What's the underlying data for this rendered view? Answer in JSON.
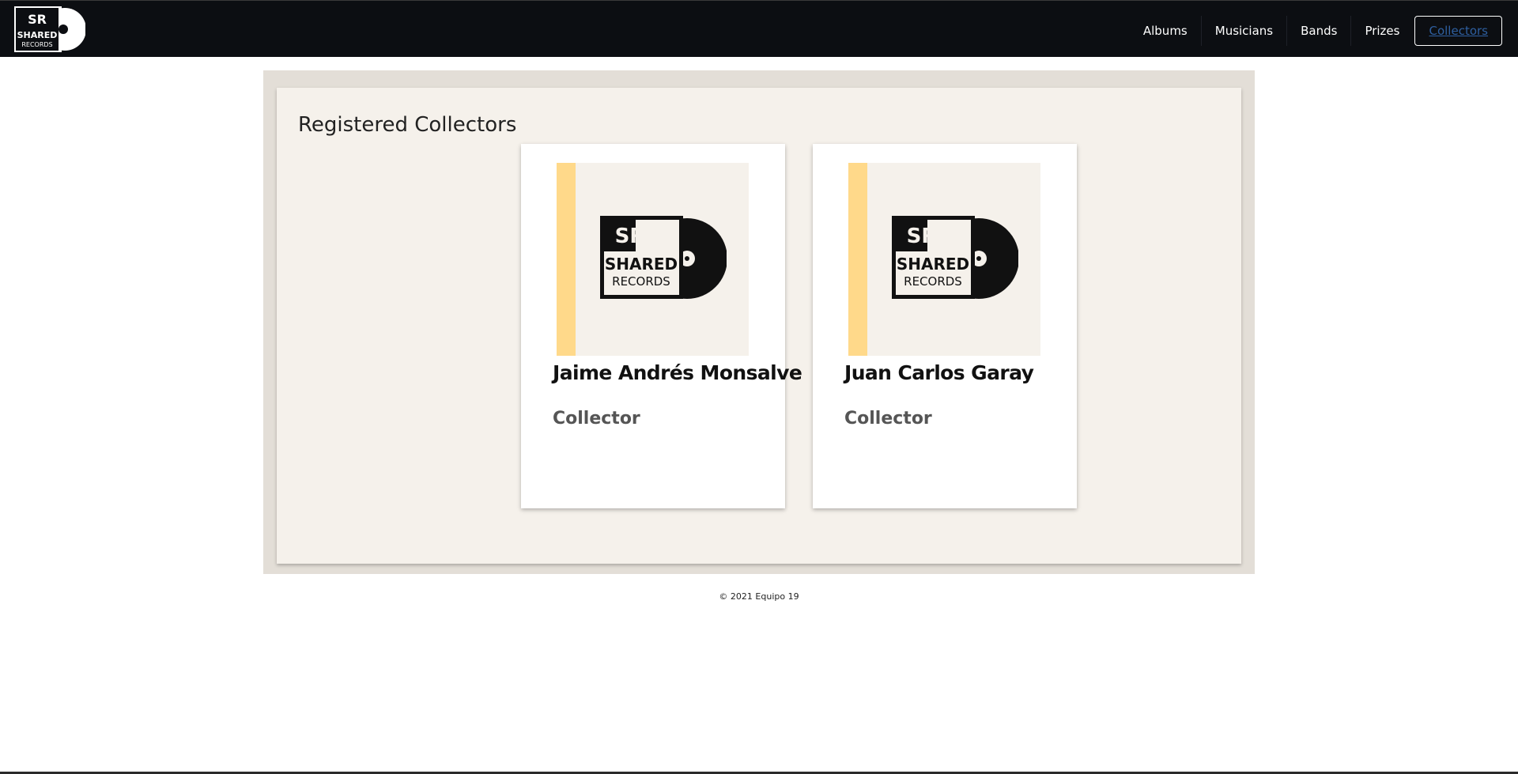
{
  "nav": {
    "brand_top": "SR",
    "brand_mid": "SHARED",
    "brand_bottom": "RECORDS",
    "links": [
      {
        "label": "Albums"
      },
      {
        "label": "Musicians"
      },
      {
        "label": "Bands"
      },
      {
        "label": "Prizes"
      },
      {
        "label": "Collectors"
      }
    ],
    "active_link": "Collectors"
  },
  "main": {
    "title": "Registered Collectors",
    "collectors": [
      {
        "name": "Jaime Andrés Monsalve",
        "role": "Collector",
        "image_icon": "shared-records-logo-icon"
      },
      {
        "name": "Juan Carlos Garay",
        "role": "Collector",
        "image_icon": "shared-records-logo-icon"
      }
    ]
  },
  "footer": {
    "text": "© 2021 Equipo 19"
  },
  "colors": {
    "navbar_bg": "#0c0e12",
    "active_link": "#2e5fa0",
    "panel_bg": "#f5f1eb",
    "panel_outer": "#e3ded7",
    "image_strip": "#ffd98a"
  }
}
